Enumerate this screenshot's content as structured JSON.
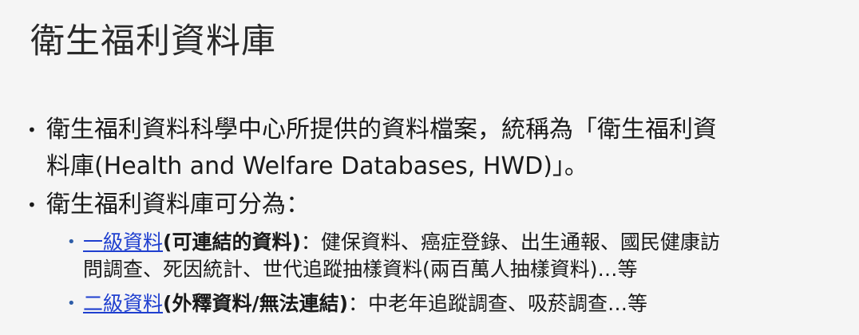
{
  "title": "衛生福利資料庫",
  "bullets": [
    {
      "text_line1": "衛生福利資料科學中心所提供的資料檔案，統稱為「衛生福利資",
      "text_line2": "料庫(Health and Welfare Databases, HWD)」。"
    },
    {
      "text": "衛生福利資料庫可分為：",
      "sub": [
        {
          "link": "一級資料",
          "bold": "(可連結的資料)",
          "rest_line1": "：健保資料、癌症登錄、出生通報、國民健康訪",
          "rest_line2": "問調查、死因統計、世代追蹤抽樣資料(兩百萬人抽樣資料)…等"
        },
        {
          "link": "二級資料",
          "bold": "(外釋資料/無法連結)",
          "rest_line1": "：中老年追蹤調查、吸菸調查…等"
        }
      ]
    }
  ],
  "colors": {
    "link": "#1f3fcf",
    "sub_bullet": "#2e5da8",
    "background": "#f5f5f5"
  }
}
